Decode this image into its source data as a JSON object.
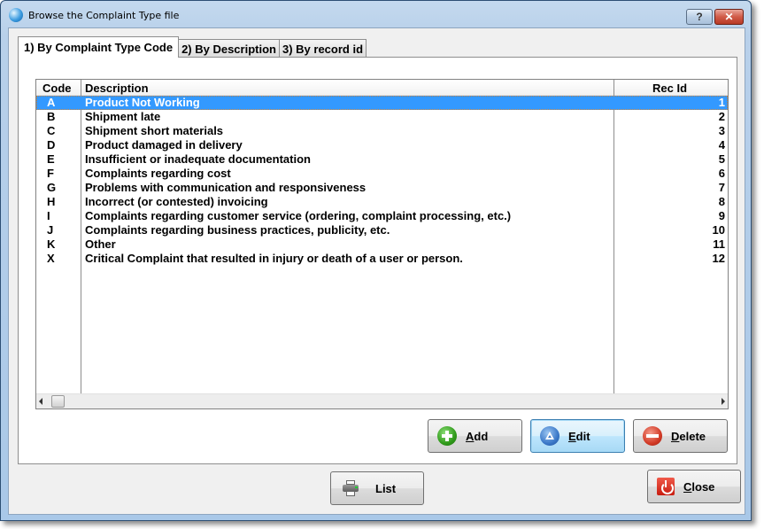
{
  "window": {
    "title": "Browse the Complaint Type file",
    "help_label": "?",
    "close_label": "✕"
  },
  "tabs": [
    {
      "label": "1) By Complaint Type Code",
      "active": true
    },
    {
      "label": "2) By Description",
      "active": false
    },
    {
      "label": "3) By record id",
      "active": false
    }
  ],
  "grid": {
    "columns": [
      "Code",
      "Description",
      "Rec Id"
    ],
    "rows": [
      {
        "code": "A",
        "description": "Product Not Working",
        "rec_id": "1",
        "selected": true
      },
      {
        "code": "B",
        "description": "Shipment late",
        "rec_id": "2"
      },
      {
        "code": "C",
        "description": "Shipment short materials",
        "rec_id": "3"
      },
      {
        "code": "D",
        "description": "Product damaged in delivery",
        "rec_id": "4"
      },
      {
        "code": "E",
        "description": "Insufficient or inadequate documentation",
        "rec_id": "5"
      },
      {
        "code": "F",
        "description": "Complaints regarding cost",
        "rec_id": "6"
      },
      {
        "code": "G",
        "description": "Problems with communication and responsiveness",
        "rec_id": "7"
      },
      {
        "code": "H",
        "description": "Incorrect (or contested) invoicing",
        "rec_id": "8"
      },
      {
        "code": "I",
        "description": "Complaints regarding customer service (ordering, complaint processing, etc.)",
        "rec_id": "9"
      },
      {
        "code": "J",
        "description": "Complaints regarding business practices, publicity, etc.",
        "rec_id": "10"
      },
      {
        "code": "K",
        "description": "Other",
        "rec_id": "11"
      },
      {
        "code": "X",
        "description": "Critical Complaint that resulted in injury or death of a user or person.",
        "rec_id": "12"
      }
    ]
  },
  "buttons": {
    "add": {
      "accel": "A",
      "rest": "dd",
      "icon": "add-icon"
    },
    "edit": {
      "accel": "E",
      "rest": "dit",
      "icon": "edit-icon"
    },
    "delete": {
      "accel": "D",
      "rest": "elete",
      "icon": "delete-icon"
    },
    "list": {
      "label": "List",
      "icon": "printer-icon"
    },
    "close": {
      "accel": "C",
      "rest": "lose",
      "icon": "power-icon"
    }
  },
  "colors": {
    "selection": "#3399ff",
    "focus_border": "#3c7fb1"
  }
}
